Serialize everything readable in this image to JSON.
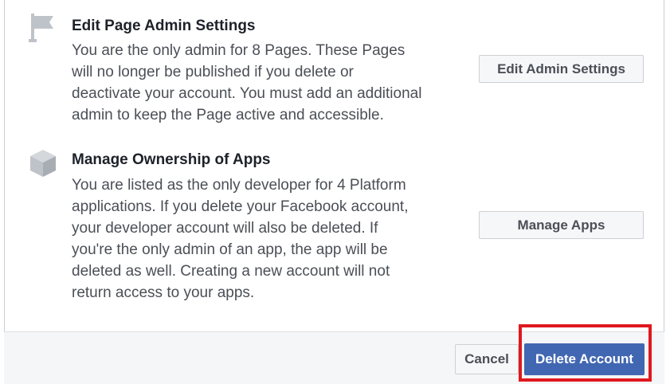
{
  "sections": [
    {
      "icon": "flag-icon",
      "title": "Edit Page Admin Settings",
      "lines": [
        "You are the only admin for 8 Pages. These Pages",
        "will no longer be published if you delete or",
        "deactivate your account. You must add an additional",
        "admin to keep the Page active and accessible."
      ],
      "button_label": "Edit Admin Settings"
    },
    {
      "icon": "cube-icon",
      "title": "Manage Ownership of Apps",
      "lines": [
        "You are listed as the only developer for 4 Platform",
        "applications. If you delete your Facebook account,",
        "your developer account will also be deleted. If",
        "you're the only admin of an app, the app will be",
        "deleted as well. Creating a new account will not",
        "return access to your apps."
      ],
      "button_label": "Manage Apps"
    }
  ],
  "footer": {
    "cancel_label": "Cancel",
    "delete_label": "Delete Account"
  },
  "colors": {
    "primary": "#4267b2",
    "highlight": "#e0181f",
    "icon_gray": "#bec3c9"
  }
}
